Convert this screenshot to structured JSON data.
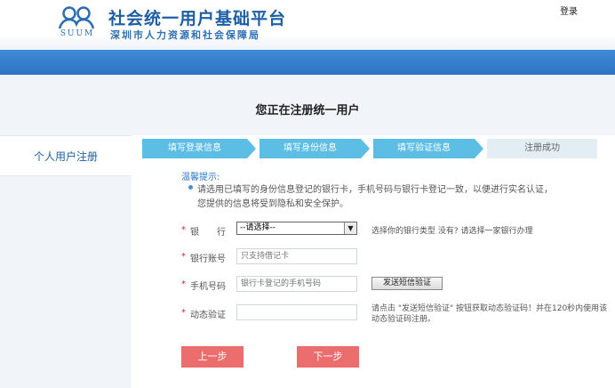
{
  "header": {
    "logo_text": "SUUM",
    "title": "社会统一用户基础平台",
    "subtitle": "深圳市人力资源和社会保障局",
    "login_label": "登录"
  },
  "page_title": "您正在注册统一用户",
  "sidebar": {
    "items": [
      {
        "label": "个人用户注册"
      }
    ]
  },
  "steps": [
    {
      "label": "填写登录信息",
      "state": "active"
    },
    {
      "label": "填写身份信息",
      "state": "active"
    },
    {
      "label": "填写验证信息",
      "state": "active"
    },
    {
      "label": "注册成功",
      "state": "inactive"
    }
  ],
  "tips": {
    "title": "温馨提示:",
    "line1": "请选用已填写的身份信息登记的银行卡，手机号码与银行卡登记一致，以便进行实名认证，",
    "line2": "您提供的信息将受到隐私和安全保护。"
  },
  "form": {
    "required_mark": "*",
    "bank": {
      "label": "银　　行",
      "selected": "--请选择--",
      "hint": "选择你的银行类型  没有? 请选择一家银行办理"
    },
    "account": {
      "label": "银行账号",
      "placeholder": "只支持借记卡"
    },
    "phone": {
      "label": "手机号码",
      "placeholder": "银行卡登记的手机号码",
      "button": "发送短信验证"
    },
    "code": {
      "label": "动态验证",
      "placeholder": "",
      "hint1": "请点击 \"发送短信验证\" 按钮获取动态验证码！并在120秒内使用该",
      "hint2": "动态验证码注册。"
    }
  },
  "buttons": {
    "prev": "上一步",
    "next": "下一步"
  },
  "colors": {
    "brand": "#1d5ea6",
    "band": "#2c74c2",
    "step_active": "#5cbde5",
    "step_inactive": "#e3edf4",
    "button": "#ec6d6d",
    "required": "#d02c2c"
  }
}
